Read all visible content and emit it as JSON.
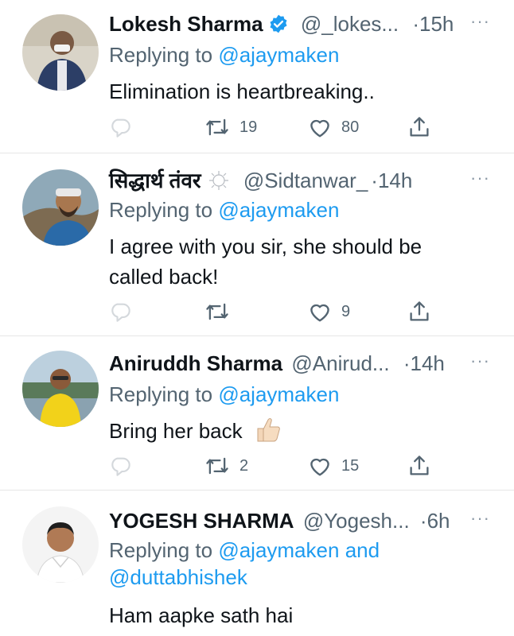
{
  "replying_prefix": "Replying to",
  "more_glyph": "···",
  "tweets": [
    {
      "name": "Lokesh Sharma",
      "handle": "@_lokes...",
      "dot": "·",
      "time": "15h",
      "reply_to": "@ajaymaken",
      "reply_to_2": "",
      "text": "Elimination is heartbreaking..",
      "retweets": "19",
      "likes": "80"
    },
    {
      "name": "सिद्धार्थ तंवर",
      "handle": "@Sidtanwar_",
      "dot": "·",
      "time": "14h",
      "reply_to": "@ajaymaken",
      "reply_to_2": "",
      "text": "I agree with you sir, she should be called back!",
      "retweets": "",
      "likes": "9"
    },
    {
      "name": "Aniruddh Sharma",
      "handle": "@Anirud...",
      "dot": "·",
      "time": "14h",
      "reply_to": "@ajaymaken",
      "reply_to_2": "",
      "text": "Bring her back",
      "retweets": "2",
      "likes": "15"
    },
    {
      "name": "YOGESH SHARMA",
      "handle": "@Yogesh...",
      "dot": "·",
      "time": "6h",
      "reply_to": "@ajaymaken",
      "and_word": "and",
      "reply_to_2": "@duttabhishek",
      "text": "Ham aapke sath hai",
      "retweets": "",
      "likes": ""
    }
  ],
  "icons": [
    "reply-icon",
    "retweet-icon",
    "like-icon",
    "share-icon",
    "verified-badge-icon",
    "thumbs-up-emoji"
  ],
  "colors": {
    "link": "#1d9bf0",
    "muted": "#536471",
    "text": "#0f1419",
    "verified": "#1d9bf0"
  }
}
